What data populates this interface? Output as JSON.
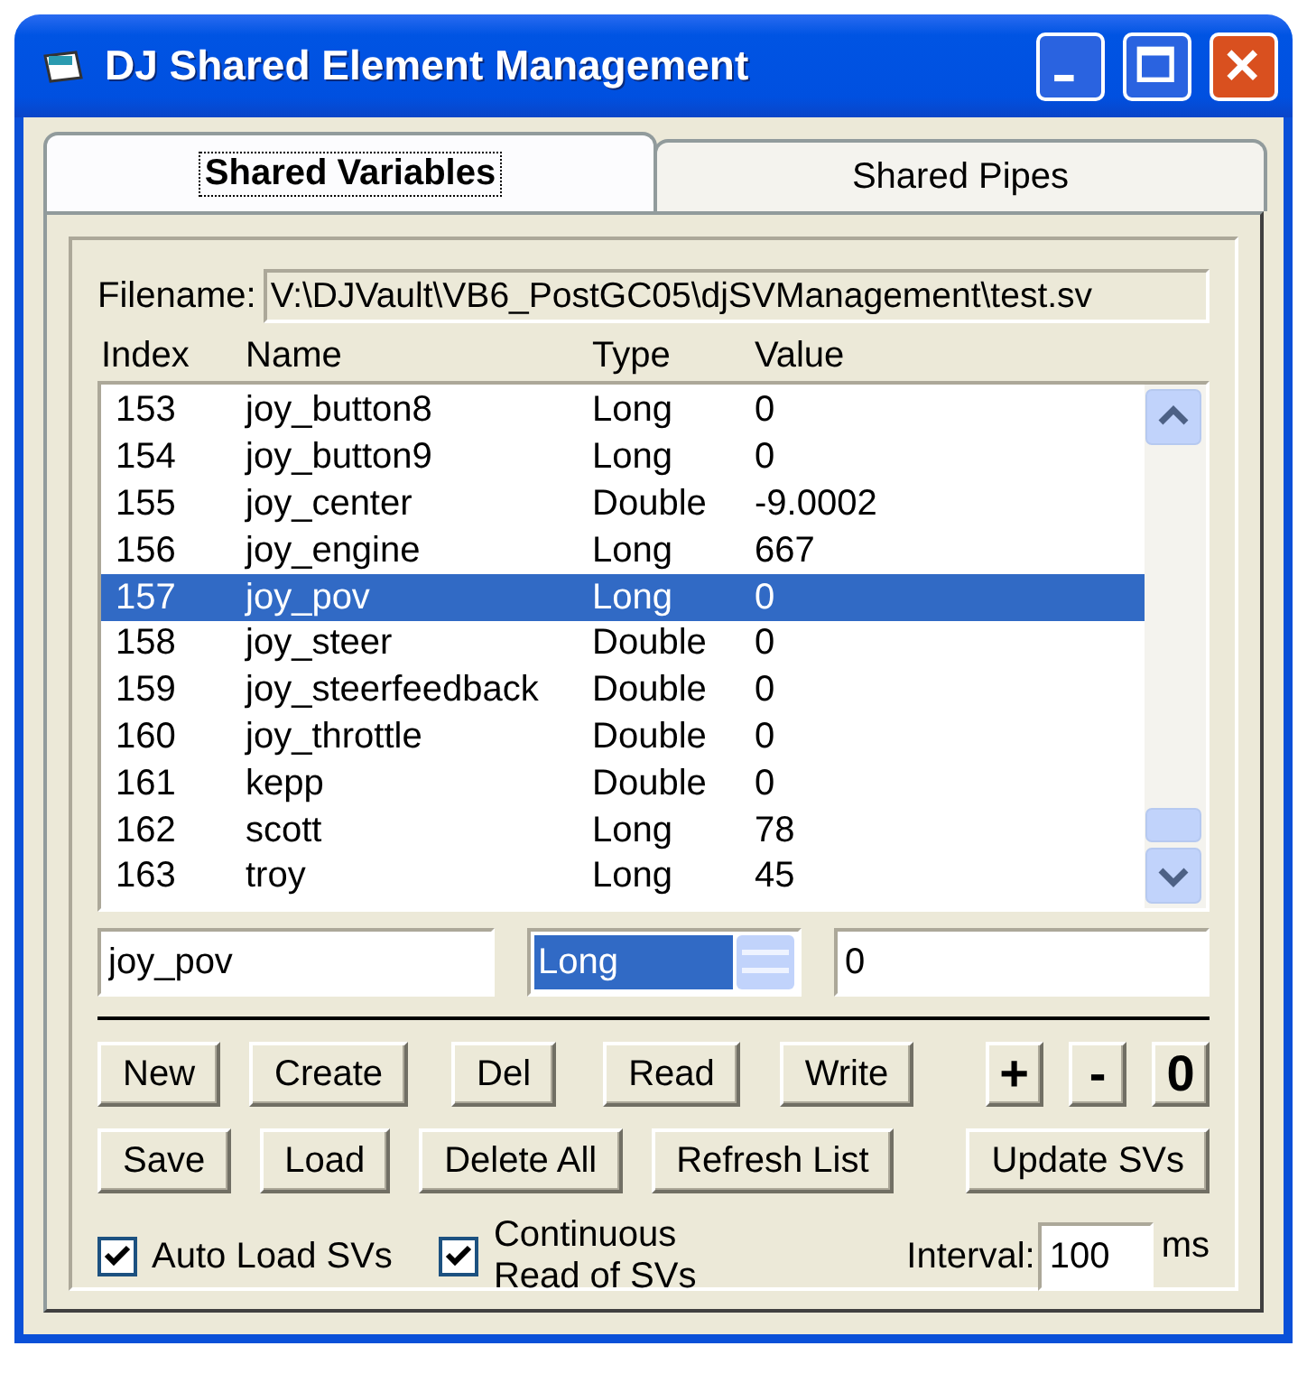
{
  "window": {
    "title": "DJ Shared Element Management"
  },
  "tabs": [
    {
      "label": "Shared Variables",
      "selected": true
    },
    {
      "label": "Shared Pipes",
      "selected": false
    }
  ],
  "filename": {
    "label": "Filename:",
    "value": "V:\\DJVault\\VB6_PostGC05\\djSVManagement\\test.sv"
  },
  "list": {
    "columns": [
      "Index",
      "Name",
      "Type",
      "Value"
    ],
    "rows": [
      {
        "cells": [
          "153",
          "joy_button8",
          "Long",
          "0"
        ],
        "selected": false
      },
      {
        "cells": [
          "154",
          "joy_button9",
          "Long",
          "0"
        ],
        "selected": false
      },
      {
        "cells": [
          "155",
          "joy_center",
          "Double",
          "-9.0002"
        ],
        "selected": false
      },
      {
        "cells": [
          "156",
          "joy_engine",
          "Long",
          "667"
        ],
        "selected": false
      },
      {
        "cells": [
          "157",
          "joy_pov",
          "Long",
          "0"
        ],
        "selected": true
      },
      {
        "cells": [
          "158",
          "joy_steer",
          "Double",
          "0"
        ],
        "selected": false
      },
      {
        "cells": [
          "159",
          "joy_steerfeedback",
          "Double",
          "0"
        ],
        "selected": false
      },
      {
        "cells": [
          "160",
          "joy_throttle",
          "Double",
          "0"
        ],
        "selected": false
      },
      {
        "cells": [
          "161",
          "kepp",
          "Double",
          "0"
        ],
        "selected": false
      },
      {
        "cells": [
          "162",
          "scott",
          "Long",
          "78"
        ],
        "selected": false
      },
      {
        "cells": [
          "163",
          "troy",
          "Long",
          "45"
        ],
        "selected": false
      }
    ]
  },
  "editor": {
    "name": "joy_pov",
    "type": "Long",
    "value": "0"
  },
  "buttons_row_1": [
    "New",
    "Create",
    "Del",
    "Read",
    "Write"
  ],
  "step_buttons": [
    "+",
    "-",
    "0"
  ],
  "buttons_row_2": [
    "Save",
    "Load",
    "Delete All",
    "Refresh List",
    "Update SVs"
  ],
  "options": [
    {
      "label": "Auto Load SVs",
      "checked": true
    },
    {
      "label": "Continuous Read of SVs",
      "checked": true
    }
  ],
  "interval": {
    "label": "Interval:",
    "value": "100",
    "unit": "ms"
  }
}
